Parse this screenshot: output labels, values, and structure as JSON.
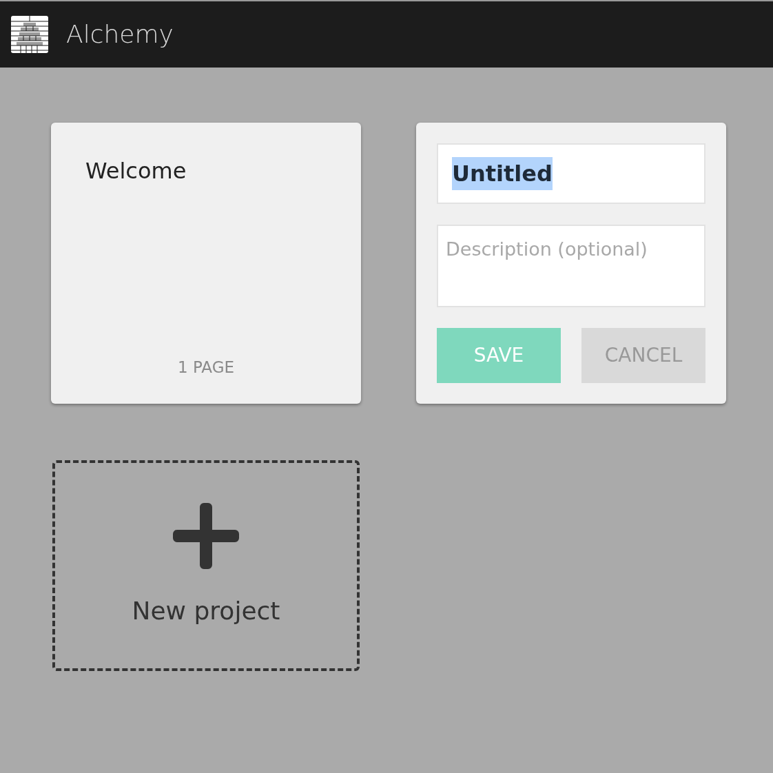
{
  "app_bar": {
    "title": "Alchemy"
  },
  "projects": [
    {
      "title": "Welcome",
      "pages": "1 PAGE"
    }
  ],
  "edit_form": {
    "title_field": {
      "value": "Untitled",
      "selected": true
    },
    "description_field": {
      "placeholder": "Description (optional)"
    },
    "buttons": [
      {
        "label": "SAVE",
        "kind": "primary"
      },
      {
        "label": "CANCEL",
        "kind": "secondary"
      }
    ]
  },
  "new_project": {
    "label": "New project"
  }
}
